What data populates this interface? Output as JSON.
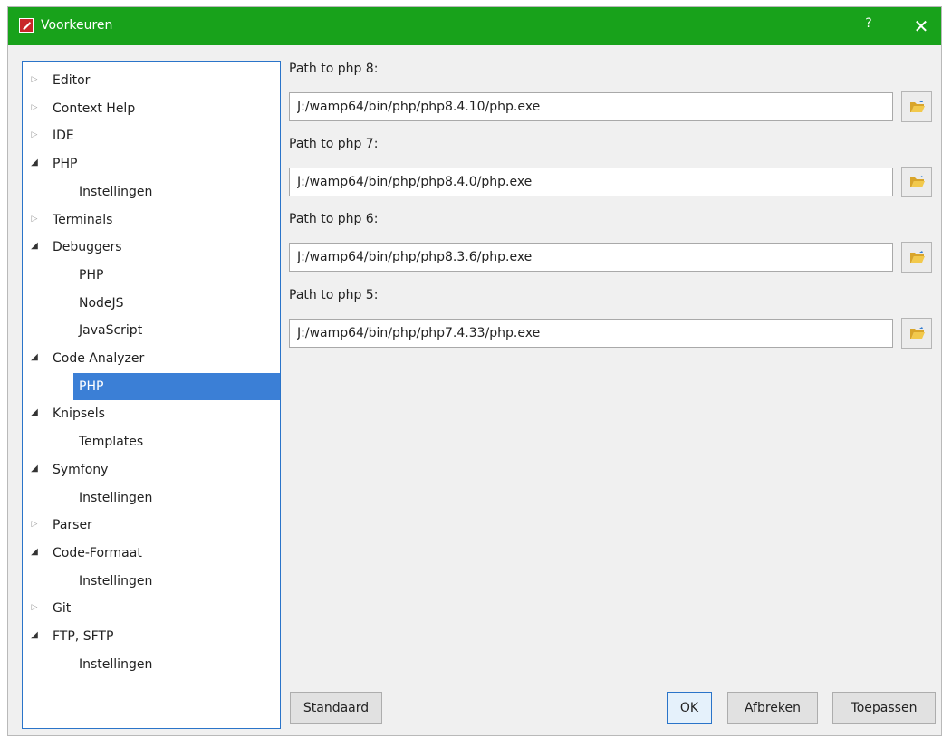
{
  "window": {
    "title": "Voorkeuren",
    "help_label": "?",
    "close_label": "✕",
    "accent": "#18a21b"
  },
  "tree": [
    {
      "label": "Editor",
      "expandable": true,
      "expanded": false,
      "level": 0
    },
    {
      "label": "Context Help",
      "expandable": true,
      "expanded": false,
      "level": 0
    },
    {
      "label": "IDE",
      "expandable": true,
      "expanded": false,
      "level": 0
    },
    {
      "label": "PHP",
      "expandable": true,
      "expanded": true,
      "level": 0
    },
    {
      "label": "Instellingen",
      "expandable": false,
      "level": 1
    },
    {
      "label": "Terminals",
      "expandable": true,
      "expanded": false,
      "level": 0
    },
    {
      "label": "Debuggers",
      "expandable": true,
      "expanded": true,
      "level": 0
    },
    {
      "label": "PHP",
      "expandable": false,
      "level": 1
    },
    {
      "label": "NodeJS",
      "expandable": false,
      "level": 1
    },
    {
      "label": "JavaScript",
      "expandable": false,
      "level": 1
    },
    {
      "label": "Code Analyzer",
      "expandable": true,
      "expanded": true,
      "level": 0
    },
    {
      "label": "PHP",
      "expandable": false,
      "level": 1,
      "selected": true
    },
    {
      "label": "Knipsels",
      "expandable": true,
      "expanded": true,
      "level": 0
    },
    {
      "label": "Templates",
      "expandable": false,
      "level": 1
    },
    {
      "label": "Symfony",
      "expandable": true,
      "expanded": true,
      "level": 0
    },
    {
      "label": "Instellingen",
      "expandable": false,
      "level": 1
    },
    {
      "label": "Parser",
      "expandable": true,
      "expanded": false,
      "level": 0
    },
    {
      "label": "Code-Formaat",
      "expandable": true,
      "expanded": true,
      "level": 0
    },
    {
      "label": "Instellingen",
      "expandable": false,
      "level": 1
    },
    {
      "label": "Git",
      "expandable": true,
      "expanded": false,
      "level": 0
    },
    {
      "label": "FTP, SFTP",
      "expandable": true,
      "expanded": true,
      "level": 0
    },
    {
      "label": "Instellingen",
      "expandable": false,
      "level": 1
    }
  ],
  "paths": [
    {
      "label": "Path to php 8:",
      "value": "J:/wamp64/bin/php/php8.4.10/php.exe",
      "browse_icon": "folder-open-icon"
    },
    {
      "label": "Path to php 7:",
      "value": "J:/wamp64/bin/php/php8.4.0/php.exe",
      "browse_icon": "folder-open-icon"
    },
    {
      "label": "Path to php 6:",
      "value": "J:/wamp64/bin/php/php8.3.6/php.exe",
      "browse_icon": "folder-open-icon"
    },
    {
      "label": "Path to php 5:",
      "value": "J:/wamp64/bin/php/php7.4.33/php.exe",
      "browse_icon": "folder-open-icon"
    }
  ],
  "buttons": {
    "standaard": "Standaard",
    "ok": "OK",
    "afbreken": "Afbreken",
    "toepassen": "Toepassen"
  }
}
